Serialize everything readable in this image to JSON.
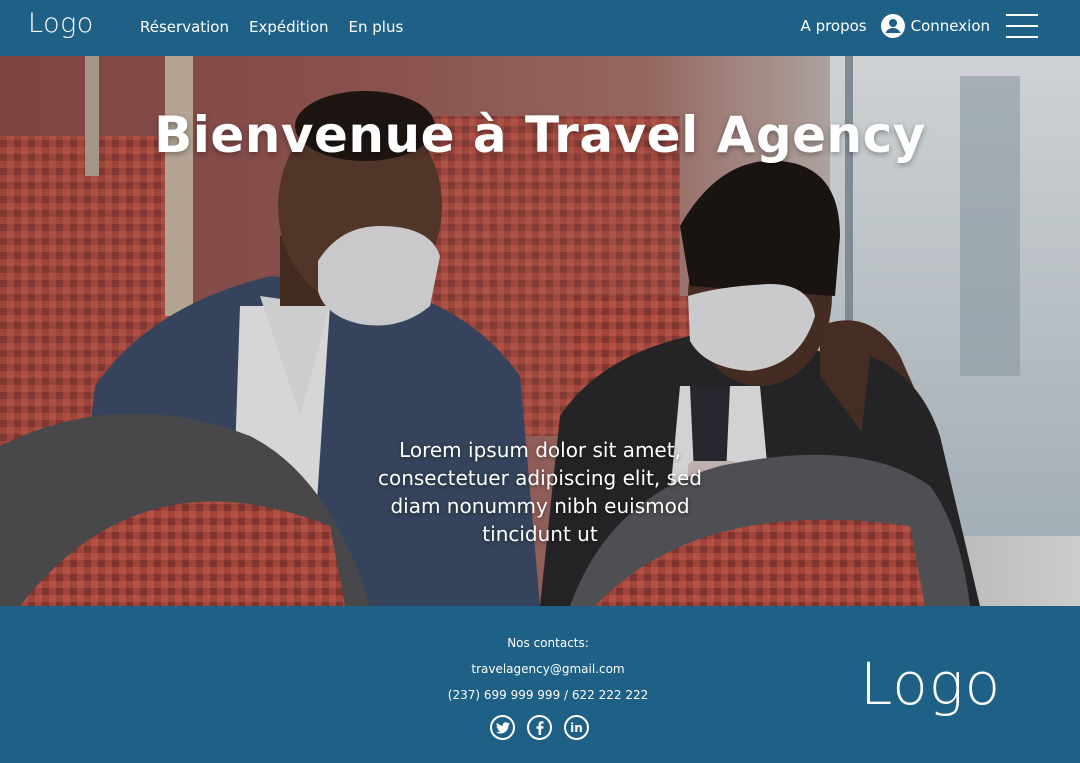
{
  "header": {
    "logo": "Logo",
    "nav": [
      "Réservation",
      "Expédition",
      "En plus"
    ],
    "apropos": "A propos",
    "connexion": "Connexion"
  },
  "hero": {
    "title": "Bienvenue à Travel Agency",
    "text": "Lorem ipsum dolor sit amet, consectetuer adipiscing elit, sed diam nonummy nibh euismod tincidunt ut"
  },
  "footer": {
    "contacts_title": "Nos contacts:",
    "email": "travelagency@gmail.com",
    "phone": "(237) 699 999 999 / 622 222 222",
    "logo": "Logo",
    "socials": [
      "twitter-icon",
      "facebook-icon",
      "linkedin-icon"
    ]
  },
  "colors": {
    "brand": "#1f6186"
  }
}
